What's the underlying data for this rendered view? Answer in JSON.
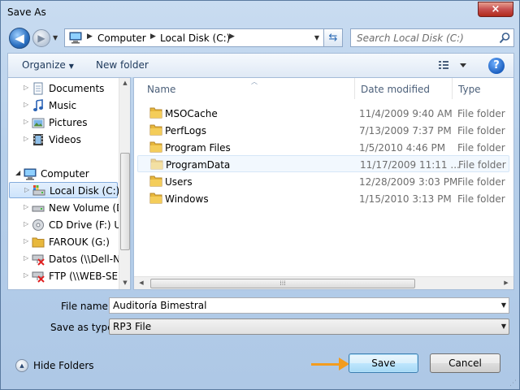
{
  "window": {
    "title": "Save As",
    "close_label": "×"
  },
  "nav": {
    "back_glyph": "◀",
    "forward_glyph": "▶",
    "breadcrumb": [
      "Computer",
      "Local Disk (C:)"
    ],
    "search_placeholder": "Search Local Disk (C:)"
  },
  "toolbar": {
    "organize_label": "Organize",
    "new_folder_label": "New folder",
    "help_label": "?"
  },
  "sidebar": {
    "items": [
      {
        "label": "Documents",
        "icon": "documents-icon"
      },
      {
        "label": "Music",
        "icon": "music-icon"
      },
      {
        "label": "Pictures",
        "icon": "pictures-icon"
      },
      {
        "label": "Videos",
        "icon": "videos-icon"
      },
      {
        "label": "Computer",
        "icon": "computer-icon"
      },
      {
        "label": "Local Disk (C:)",
        "icon": "local-disk-icon"
      },
      {
        "label": "New Volume (D:",
        "icon": "drive-icon"
      },
      {
        "label": "CD Drive (F:) U3",
        "icon": "cd-drive-icon"
      },
      {
        "label": "FAROUK (G:)",
        "icon": "usb-drive-icon"
      },
      {
        "label": "Datos (\\\\Dell-Na",
        "icon": "network-drive-disconnected-icon"
      },
      {
        "label": "FTP (\\\\WEB-SER",
        "icon": "network-drive-disconnected-icon"
      }
    ]
  },
  "files": {
    "columns": {
      "name": "Name",
      "date": "Date modified",
      "type": "Type"
    },
    "rows": [
      {
        "name": "MSOCache",
        "date": "11/4/2009 9:40 AM",
        "type": "File folder"
      },
      {
        "name": "PerfLogs",
        "date": "7/13/2009 7:37 PM",
        "type": "File folder"
      },
      {
        "name": "Program Files",
        "date": "1/5/2010 4:46 PM",
        "type": "File folder"
      },
      {
        "name": "ProgramData",
        "date": "11/17/2009 11:11 ...",
        "type": "File folder"
      },
      {
        "name": "Users",
        "date": "12/28/2009 3:03 PM",
        "type": "File folder"
      },
      {
        "name": "Windows",
        "date": "1/15/2010 3:13 PM",
        "type": "File folder"
      }
    ]
  },
  "form": {
    "file_name_label": "File name:",
    "file_name_value": "Auditoría Bimestral",
    "save_type_label": "Save as type:",
    "save_type_value": "RP3 File"
  },
  "footer": {
    "hide_folders_label": "Hide Folders",
    "save_label": "Save",
    "cancel_label": "Cancel"
  },
  "colors": {
    "accent_arrow": "#f39c1f",
    "folder": "#e8b83c"
  }
}
